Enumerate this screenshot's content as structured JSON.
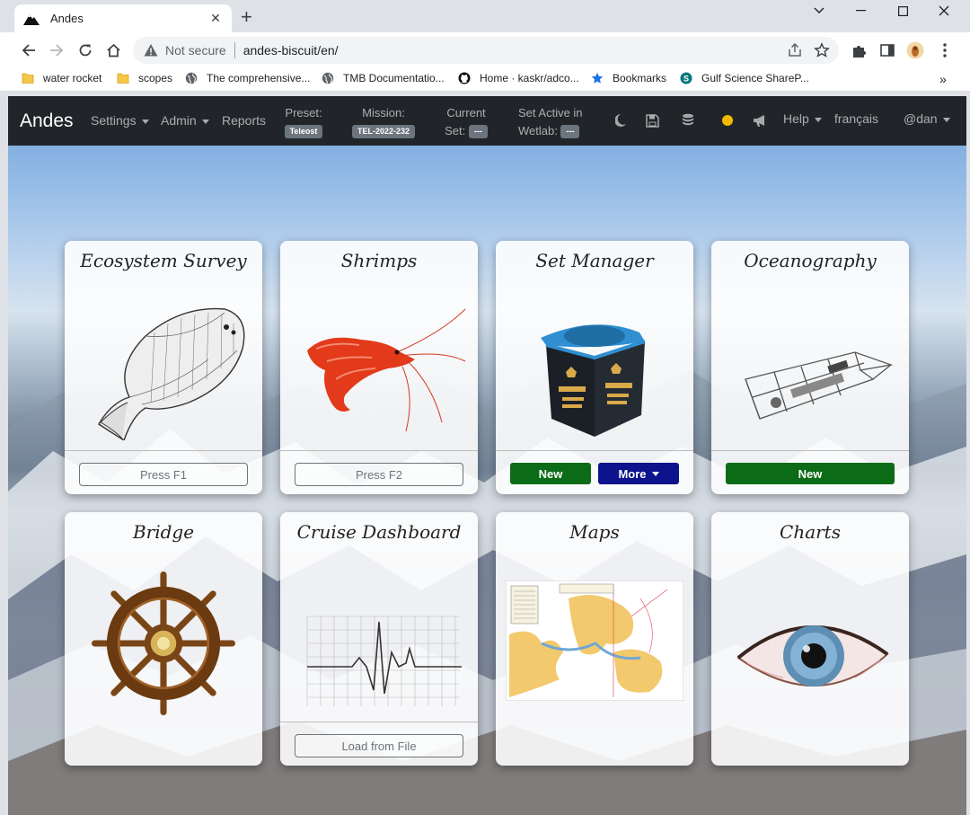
{
  "browser": {
    "tab_title": "Andes",
    "omnibox": {
      "security": "Not secure",
      "url": "andes-biscuit/en/"
    },
    "bookmarks": [
      {
        "label": "water rocket",
        "icon": "folder-icon"
      },
      {
        "label": "scopes",
        "icon": "folder-icon"
      },
      {
        "label": "The comprehensive...",
        "icon": "globe-icon"
      },
      {
        "label": "TMB Documentatio...",
        "icon": "globe-icon"
      },
      {
        "label": "Home · kaskr/adco...",
        "icon": "github-icon"
      },
      {
        "label": "Bookmarks",
        "icon": "star-icon"
      },
      {
        "label": "Gulf Science ShareP...",
        "icon": "sharepoint-icon"
      }
    ],
    "bookmarks_overflow": "»"
  },
  "app": {
    "brand": "Andes",
    "nav": {
      "settings": "Settings",
      "admin": "Admin",
      "reports": "Reports",
      "preset_label": "Preset:",
      "preset_value": "Teleost",
      "mission_label": "Mission:",
      "mission_value": "TEL-2022-232",
      "current_label": "Current",
      "set_label": "Set:",
      "set_value": "---",
      "active_label": "Set Active in",
      "wetlab_label": "Wetlab:",
      "wetlab_value": "---",
      "help": "Help",
      "language": "français",
      "user": "@dan"
    },
    "status_color": "#f5b800",
    "cards": [
      {
        "title": "Ecosystem Survey",
        "image": "flounder-fish",
        "buttons": [
          {
            "label": "Press F1",
            "style": "ghost"
          }
        ]
      },
      {
        "title": "Shrimps",
        "image": "red-shrimp",
        "buttons": [
          {
            "label": "Press F2",
            "style": "ghost"
          }
        ]
      },
      {
        "title": "Set Manager",
        "image": "billiard-chalk",
        "buttons": [
          {
            "label": "New",
            "style": "success"
          },
          {
            "label": "More",
            "style": "primary"
          }
        ]
      },
      {
        "title": "Oceanography",
        "image": "ctd-rosette",
        "buttons": [
          {
            "label": "New",
            "style": "success"
          }
        ]
      },
      {
        "title": "Bridge",
        "image": "ship-wheel",
        "buttons": []
      },
      {
        "title": "Cruise Dashboard",
        "image": "heartbeat-grid",
        "buttons": [
          {
            "label": "Load from File",
            "style": "ghost"
          }
        ]
      },
      {
        "title": "Maps",
        "image": "nautical-chart",
        "buttons": []
      },
      {
        "title": "Charts",
        "image": "blue-eye",
        "buttons": []
      }
    ],
    "colors": {
      "success": "#0b6b16",
      "primary": "#0c138c",
      "navbar": "#212529"
    }
  }
}
